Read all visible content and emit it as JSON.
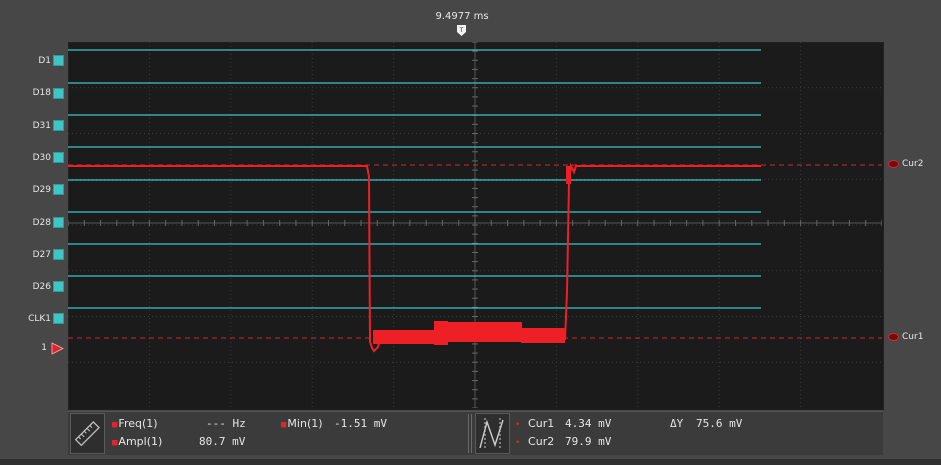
{
  "timebase": {
    "trigger_time": "9.4977 ms",
    "trigger_marker": "T"
  },
  "channels": [
    "D1",
    "D18",
    "D31",
    "D30",
    "D29",
    "D28",
    "D27",
    "D26",
    "CLK1",
    "1"
  ],
  "cursors": {
    "cur1_label": "Cur1",
    "cur2_label": "Cur2"
  },
  "colors": {
    "analog_trace": "#ee2026",
    "digital": "#3ec6c6",
    "screen_bg": "#1b1b1b",
    "grid": "#3a3a3a"
  },
  "measurements": {
    "icon_left": "ruler-icon",
    "icon_right": "cursor-waveform-icon",
    "freq": {
      "label": "Freq(1)",
      "value": "--- Hz"
    },
    "ampl": {
      "label": "Ampl(1)",
      "value": "80.7 mV"
    },
    "min": {
      "label": "Min(1)",
      "value": "-1.51 mV"
    },
    "cur1": {
      "label": "Cur1",
      "value": "4.34 mV"
    },
    "cur2": {
      "label": "Cur2",
      "value": "79.9 mV"
    },
    "delta_y": {
      "label": "ΔY",
      "value": "75.6 mV"
    }
  }
}
